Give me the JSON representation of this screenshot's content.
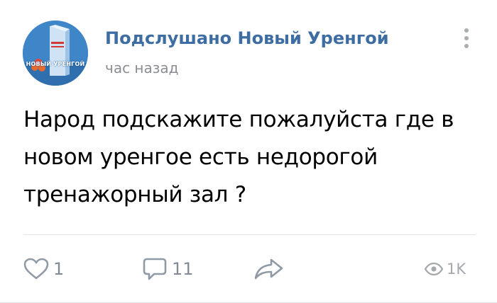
{
  "post": {
    "author": "Подслушано Новый Уренгой",
    "time": "час назад",
    "avatar_text": "НОВЫЙ УРЕНГОЙ",
    "text": "Народ подскажите пожалуйста где в новом уренгое есть недорогой тренажорный зал ?"
  },
  "actions": {
    "likes": "1",
    "comments": "11",
    "views": "1K"
  },
  "colors": {
    "author": "#3e6da3",
    "muted": "#828a94",
    "icon": "#909aa5"
  },
  "icons": [
    "heart-icon",
    "comment-icon",
    "share-icon",
    "eye-icon",
    "more-vertical-icon"
  ]
}
